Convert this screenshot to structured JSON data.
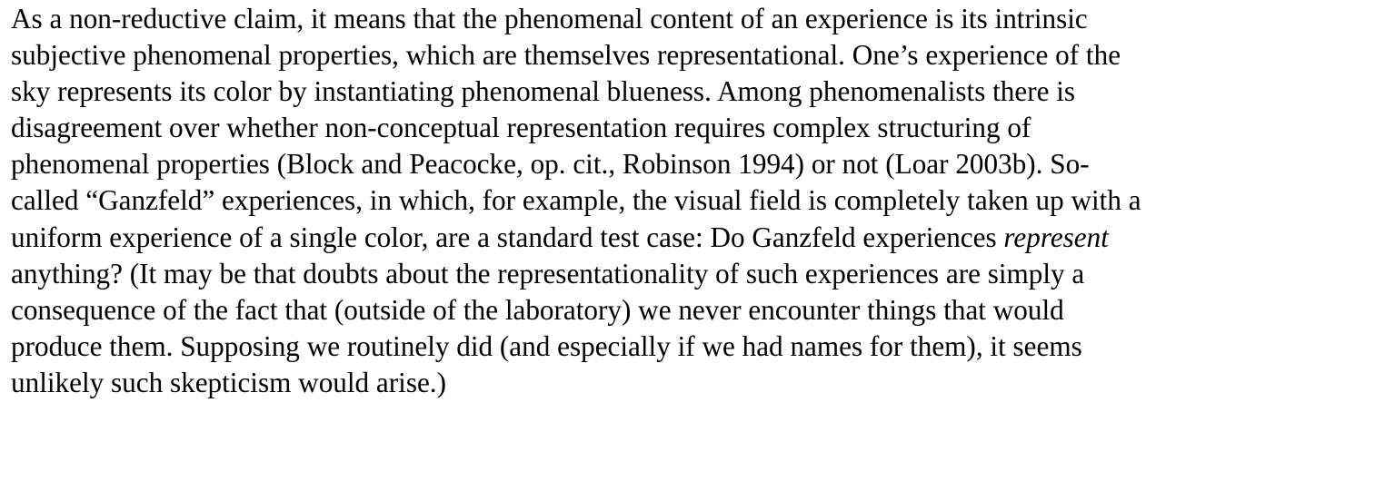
{
  "paragraph": {
    "lines": [
      "As a non-reductive claim, it means that the phenomenal content of an experience is its intrinsic",
      "subjective phenomenal properties, which are themselves representational. One’s experience of the",
      "sky represents its color by instantiating phenomenal blueness. Among phenomenalists there is",
      "disagreement over whether non-conceptual representation requires complex structuring of",
      "phenomenal properties (Block and Peacocke, op. cit., Robinson 1994) or not (Loar 2003b). So-",
      "called “Ganzfeld” experiences, in which, for example, the visual field is completely taken up with a",
      {
        "before": "uniform experience of a single color, are a standard test case: Do Ganzfeld experiences ",
        "emphasis": "represent"
      },
      "anything? (It may be that doubts about the representationality of such experiences are simply a",
      "consequence of the fact that (outside of the laboratory) we never encounter things that would",
      "produce them. Supposing we routinely did (and especially if we had names for them), it seems",
      "unlikely such skepticism would arise.)"
    ]
  }
}
